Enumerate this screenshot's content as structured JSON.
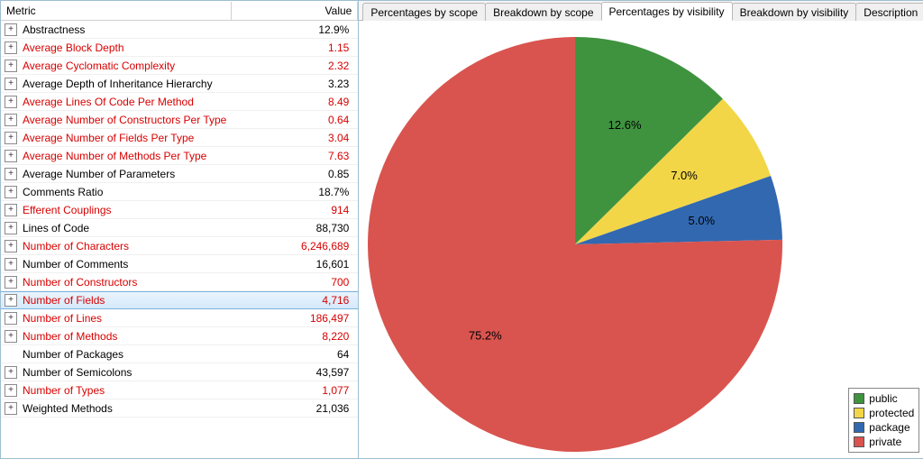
{
  "columns": {
    "metric": "Metric",
    "value": "Value"
  },
  "metrics": [
    {
      "name": "Abstractness",
      "value": "12.9%",
      "warn": false,
      "expandable": true
    },
    {
      "name": "Average Block Depth",
      "value": "1.15",
      "warn": true,
      "expandable": true
    },
    {
      "name": "Average Cyclomatic Complexity",
      "value": "2.32",
      "warn": true,
      "expandable": true
    },
    {
      "name": "Average Depth of Inheritance Hierarchy",
      "value": "3.23",
      "warn": false,
      "expandable": true
    },
    {
      "name": "Average Lines Of Code Per Method",
      "value": "8.49",
      "warn": true,
      "expandable": true
    },
    {
      "name": "Average Number of Constructors Per Type",
      "value": "0.64",
      "warn": true,
      "expandable": true
    },
    {
      "name": "Average Number of Fields Per Type",
      "value": "3.04",
      "warn": true,
      "expandable": true
    },
    {
      "name": "Average Number of Methods Per Type",
      "value": "7.63",
      "warn": true,
      "expandable": true
    },
    {
      "name": "Average Number of Parameters",
      "value": "0.85",
      "warn": false,
      "expandable": true
    },
    {
      "name": "Comments Ratio",
      "value": "18.7%",
      "warn": false,
      "expandable": true
    },
    {
      "name": "Efferent Couplings",
      "value": "914",
      "warn": true,
      "expandable": true
    },
    {
      "name": "Lines of Code",
      "value": "88,730",
      "warn": false,
      "expandable": true
    },
    {
      "name": "Number of Characters",
      "value": "6,246,689",
      "warn": true,
      "expandable": true
    },
    {
      "name": "Number of Comments",
      "value": "16,601",
      "warn": false,
      "expandable": true
    },
    {
      "name": "Number of Constructors",
      "value": "700",
      "warn": true,
      "expandable": true
    },
    {
      "name": "Number of Fields",
      "value": "4,716",
      "warn": true,
      "expandable": true,
      "selected": true
    },
    {
      "name": "Number of Lines",
      "value": "186,497",
      "warn": true,
      "expandable": true
    },
    {
      "name": "Number of Methods",
      "value": "8,220",
      "warn": true,
      "expandable": true
    },
    {
      "name": "Number of Packages",
      "value": "64",
      "warn": false,
      "expandable": false
    },
    {
      "name": "Number of Semicolons",
      "value": "43,597",
      "warn": false,
      "expandable": true
    },
    {
      "name": "Number of Types",
      "value": "1,077",
      "warn": true,
      "expandable": true
    },
    {
      "name": "Weighted Methods",
      "value": "21,036",
      "warn": false,
      "expandable": true
    }
  ],
  "tabs": [
    {
      "label": "Percentages by scope",
      "active": false
    },
    {
      "label": "Breakdown by scope",
      "active": false
    },
    {
      "label": "Percentages by visibility",
      "active": true
    },
    {
      "label": "Breakdown by visibility",
      "active": false
    },
    {
      "label": "Description",
      "active": false
    }
  ],
  "chart_data": {
    "type": "pie",
    "title": "Percentages by visibility",
    "series": [
      {
        "name": "public",
        "value": 12.6,
        "label": "12.6%",
        "color": "#3f933f"
      },
      {
        "name": "protected",
        "value": 7.0,
        "label": "7.0%",
        "color": "#f2d648"
      },
      {
        "name": "package",
        "value": 5.0,
        "label": "5.0%",
        "color": "#3268b0"
      },
      {
        "name": "private",
        "value": 75.2,
        "label": "75.2%",
        "color": "#d9544f"
      }
    ],
    "legend": [
      "public",
      "protected",
      "package",
      "private"
    ]
  }
}
